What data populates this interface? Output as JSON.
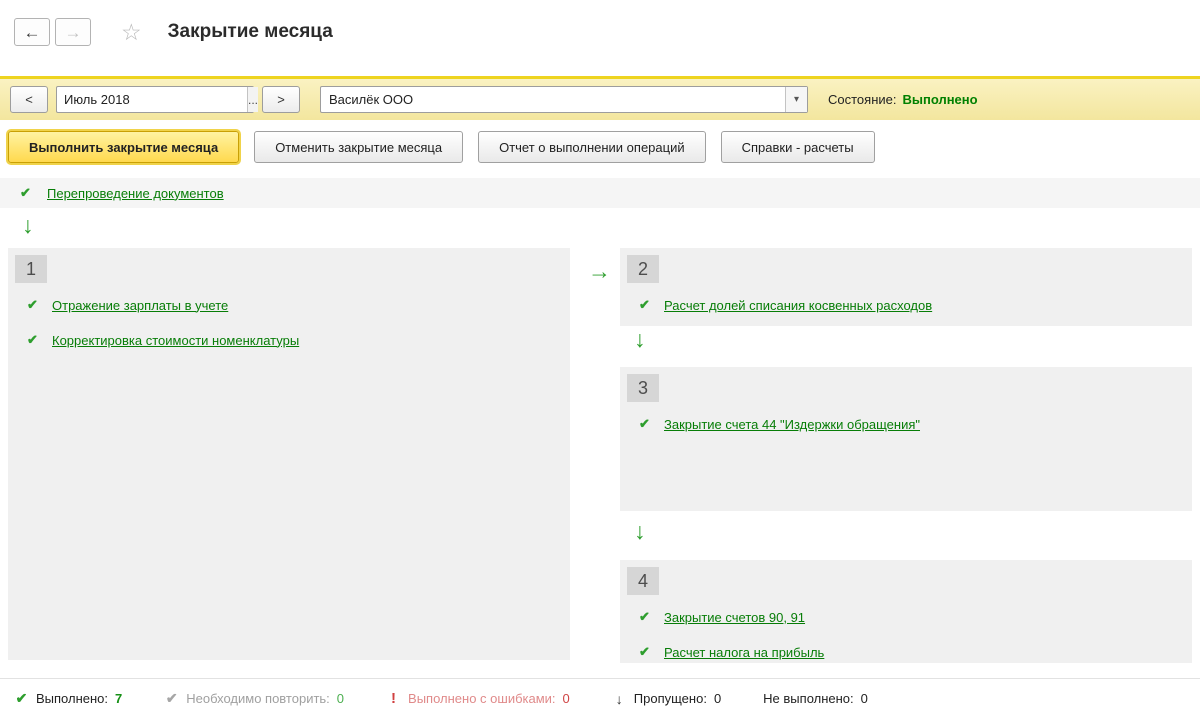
{
  "colors": {
    "accent_green": "#077d07",
    "status_green": "#018001",
    "bar_yellow": "#f3e69e",
    "highlight_yellow": "#ffd94e",
    "block_gray": "#f0f0f0",
    "error_red": "#d04545"
  },
  "icons": {
    "back": "←",
    "forward": "→",
    "star": "☆",
    "prev": "<",
    "next": ">",
    "ellipsis": "...",
    "dropdown": "▾",
    "check": "✔",
    "arrow_down": "↓",
    "arrow_right": "→",
    "error_mark": "!"
  },
  "header": {
    "title": "Закрытие месяца"
  },
  "toolbar": {
    "period_value": "Июль 2018",
    "organization": "Василёк ООО",
    "status_label": "Состояние:",
    "status_value": "Выполнено"
  },
  "actions": {
    "run": "Выполнить закрытие месяца",
    "cancel": "Отменить закрытие месяца",
    "report": "Отчет о выполнении операций",
    "references": "Справки - расчеты"
  },
  "reposting": {
    "label": "Перепроведение документов"
  },
  "stages": [
    {
      "number": "1",
      "items": [
        "Отражение зарплаты в учете",
        "Корректировка стоимости номенклатуры"
      ]
    },
    {
      "number": "2",
      "items": [
        "Расчет долей списания косвенных расходов"
      ]
    },
    {
      "number": "3",
      "items": [
        "Закрытие счета 44 \"Издержки обращения\""
      ]
    },
    {
      "number": "4",
      "items": [
        "Закрытие счетов 90, 91",
        "Расчет налога на прибыль"
      ]
    }
  ],
  "footer": {
    "done_label": "Выполнено:",
    "done_value": "7",
    "repeat_label": "Необходимо повторить:",
    "repeat_value": "0",
    "errors_label": "Выполнено с ошибками:",
    "errors_value": "0",
    "skipped_label": "Пропущено:",
    "skipped_value": "0",
    "not_done_label": "Не выполнено:",
    "not_done_value": "0"
  }
}
